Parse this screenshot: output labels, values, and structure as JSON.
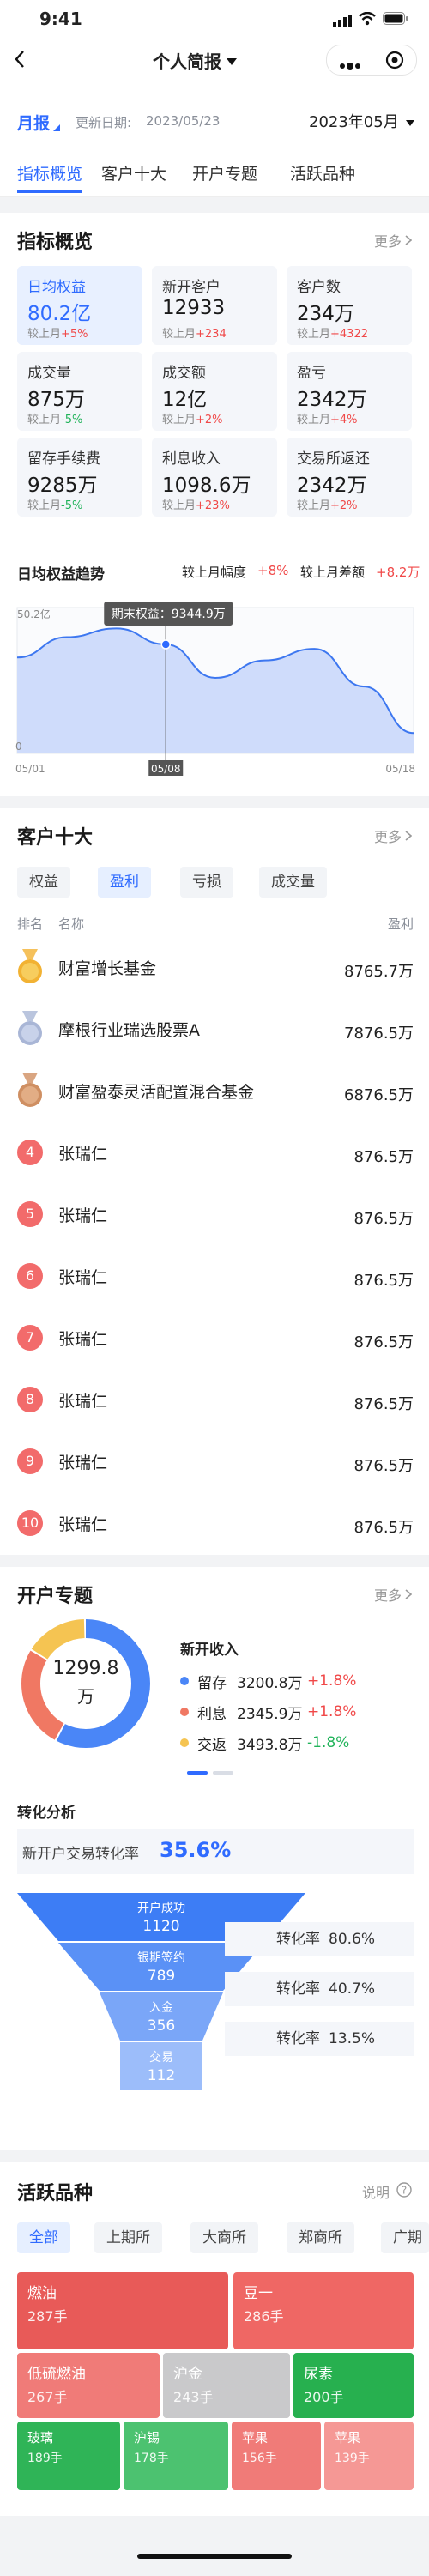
{
  "status": {
    "time": "9:41"
  },
  "nav": {
    "title": "个人简报"
  },
  "filter": {
    "period": "月报",
    "update_label": "更新日期:",
    "update_date": "2023/05/23",
    "month": "2023年05月"
  },
  "tabs": [
    "指标概览",
    "客户十大",
    "开户专题",
    "活跃品种"
  ],
  "overview": {
    "title": "指标概览",
    "more": "更多",
    "metrics": [
      {
        "label": "日均权益",
        "value": "80.2亿",
        "cmp_label": "较上月",
        "cmp": "+5%",
        "trend": "up"
      },
      {
        "label": "新开客户",
        "value": "12933",
        "cmp_label": "较上月",
        "cmp": "+234",
        "trend": "up"
      },
      {
        "label": "客户数",
        "value": "234万",
        "cmp_label": "较上月",
        "cmp": "+4322",
        "trend": "up"
      },
      {
        "label": "成交量",
        "value": "875万",
        "cmp_label": "较上月",
        "cmp": "-5%",
        "trend": "down"
      },
      {
        "label": "成交额",
        "value": "12亿",
        "cmp_label": "较上月",
        "cmp": "+2%",
        "trend": "up"
      },
      {
        "label": "盈亏",
        "value": "2342万",
        "cmp_label": "较上月",
        "cmp": "+4%",
        "trend": "up"
      },
      {
        "label": "留存手续费",
        "value": "9285万",
        "cmp_label": "较上月",
        "cmp": "-5%",
        "trend": "down"
      },
      {
        "label": "利息收入",
        "value": "1098.6万",
        "cmp_label": "较上月",
        "cmp": "+23%",
        "trend": "up"
      },
      {
        "label": "交易所返还",
        "value": "2342万",
        "cmp_label": "较上月",
        "cmp": "+2%",
        "trend": "up"
      }
    ],
    "trend": {
      "title": "日均权益趋势",
      "mom_label": "较上月幅度",
      "mom": "+8%",
      "diff_label": "较上月差额",
      "diff": "+8.2万",
      "ymax_label": "50.2亿",
      "ymin_label": "0",
      "x_start": "05/01",
      "x_mid": "05/08",
      "x_end": "05/18",
      "tooltip": "期末权益：9344.9万"
    }
  },
  "chart_data": {
    "type": "area",
    "x": [
      "05/01",
      "05/03",
      "05/05",
      "05/08",
      "05/10",
      "05/12",
      "05/14",
      "05/16",
      "05/18"
    ],
    "values": [
      33,
      40,
      43,
      37.5,
      26,
      32,
      36,
      23,
      7
    ],
    "ylim": [
      0,
      50.2
    ],
    "highlight": "05/08"
  },
  "top10": {
    "title": "客户十大",
    "more": "更多",
    "chips": [
      "权益",
      "盈利",
      "亏损",
      "成交量"
    ],
    "col_rank": "排名",
    "col_name": "名称",
    "col_value": "盈利",
    "rows": [
      {
        "rank": "1",
        "name": "财富增长基金",
        "value": "8765.7万",
        "medal": "gold"
      },
      {
        "rank": "2",
        "name": "摩根行业瑞选股票A",
        "value": "7876.5万",
        "medal": "silver"
      },
      {
        "rank": "3",
        "name": "财富盈泰灵活配置混合基金",
        "value": "6876.5万",
        "medal": "bronze"
      },
      {
        "rank": "4",
        "name": "张瑞仁",
        "value": "876.5万"
      },
      {
        "rank": "5",
        "name": "张瑞仁",
        "value": "876.5万"
      },
      {
        "rank": "6",
        "name": "张瑞仁",
        "value": "876.5万"
      },
      {
        "rank": "7",
        "name": "张瑞仁",
        "value": "876.5万"
      },
      {
        "rank": "8",
        "name": "张瑞仁",
        "value": "876.5万"
      },
      {
        "rank": "9",
        "name": "张瑞仁",
        "value": "876.5万"
      },
      {
        "rank": "10",
        "name": "张瑞仁",
        "value": "876.5万"
      }
    ]
  },
  "open": {
    "title": "开户专题",
    "more": "更多",
    "donut_value": "1299.8",
    "donut_unit": "万",
    "legend_title": "新开收入",
    "legend": [
      {
        "name": "留存",
        "value": "3200.8万",
        "rate": "+1.8%",
        "color": "#4a86f7",
        "trend": "up",
        "share": 0.58
      },
      {
        "name": "利息",
        "value": "2345.9万",
        "rate": "+1.8%",
        "color": "#f07863",
        "trend": "up",
        "share": 0.26
      },
      {
        "name": "交返",
        "value": "3493.8万",
        "rate": "-1.8%",
        "color": "#f5c452",
        "trend": "down",
        "share": 0.16
      }
    ],
    "conv_title": "转化分析",
    "conv_label": "新开户交易转化率",
    "conv_value": "35.6%",
    "funnel": [
      {
        "label": "开户成功",
        "value": "1120"
      },
      {
        "label": "银期签约",
        "value": "789"
      },
      {
        "label": "入金",
        "value": "356"
      },
      {
        "label": "交易",
        "value": "112"
      }
    ],
    "rates": [
      {
        "label": "转化率",
        "value": "80.6%"
      },
      {
        "label": "转化率",
        "value": "40.7%"
      },
      {
        "label": "转化率",
        "value": "13.5%"
      }
    ]
  },
  "active": {
    "title": "活跃品种",
    "help": "说明",
    "chips": [
      "全部",
      "上期所",
      "大商所",
      "郑商所",
      "广期"
    ],
    "tiles": [
      {
        "name": "燃油",
        "value": "287手",
        "color": "#e85a58"
      },
      {
        "name": "豆一",
        "value": "286手",
        "color": "#ef6764"
      },
      {
        "name": "低硫燃油",
        "value": "267手",
        "color": "#f07b78"
      },
      {
        "name": "沪金",
        "value": "243手",
        "color": "#c9c9cb"
      },
      {
        "name": "尿素",
        "value": "200手",
        "color": "#27b04f"
      },
      {
        "name": "玻璃",
        "value": "189手",
        "color": "#2fb457"
      },
      {
        "name": "沪锡",
        "value": "178手",
        "color": "#4cc270"
      },
      {
        "name": "苹果",
        "value": "156手",
        "color": "#f07b78"
      },
      {
        "name": "苹果",
        "value": "139手",
        "color": "#f59895"
      }
    ]
  }
}
